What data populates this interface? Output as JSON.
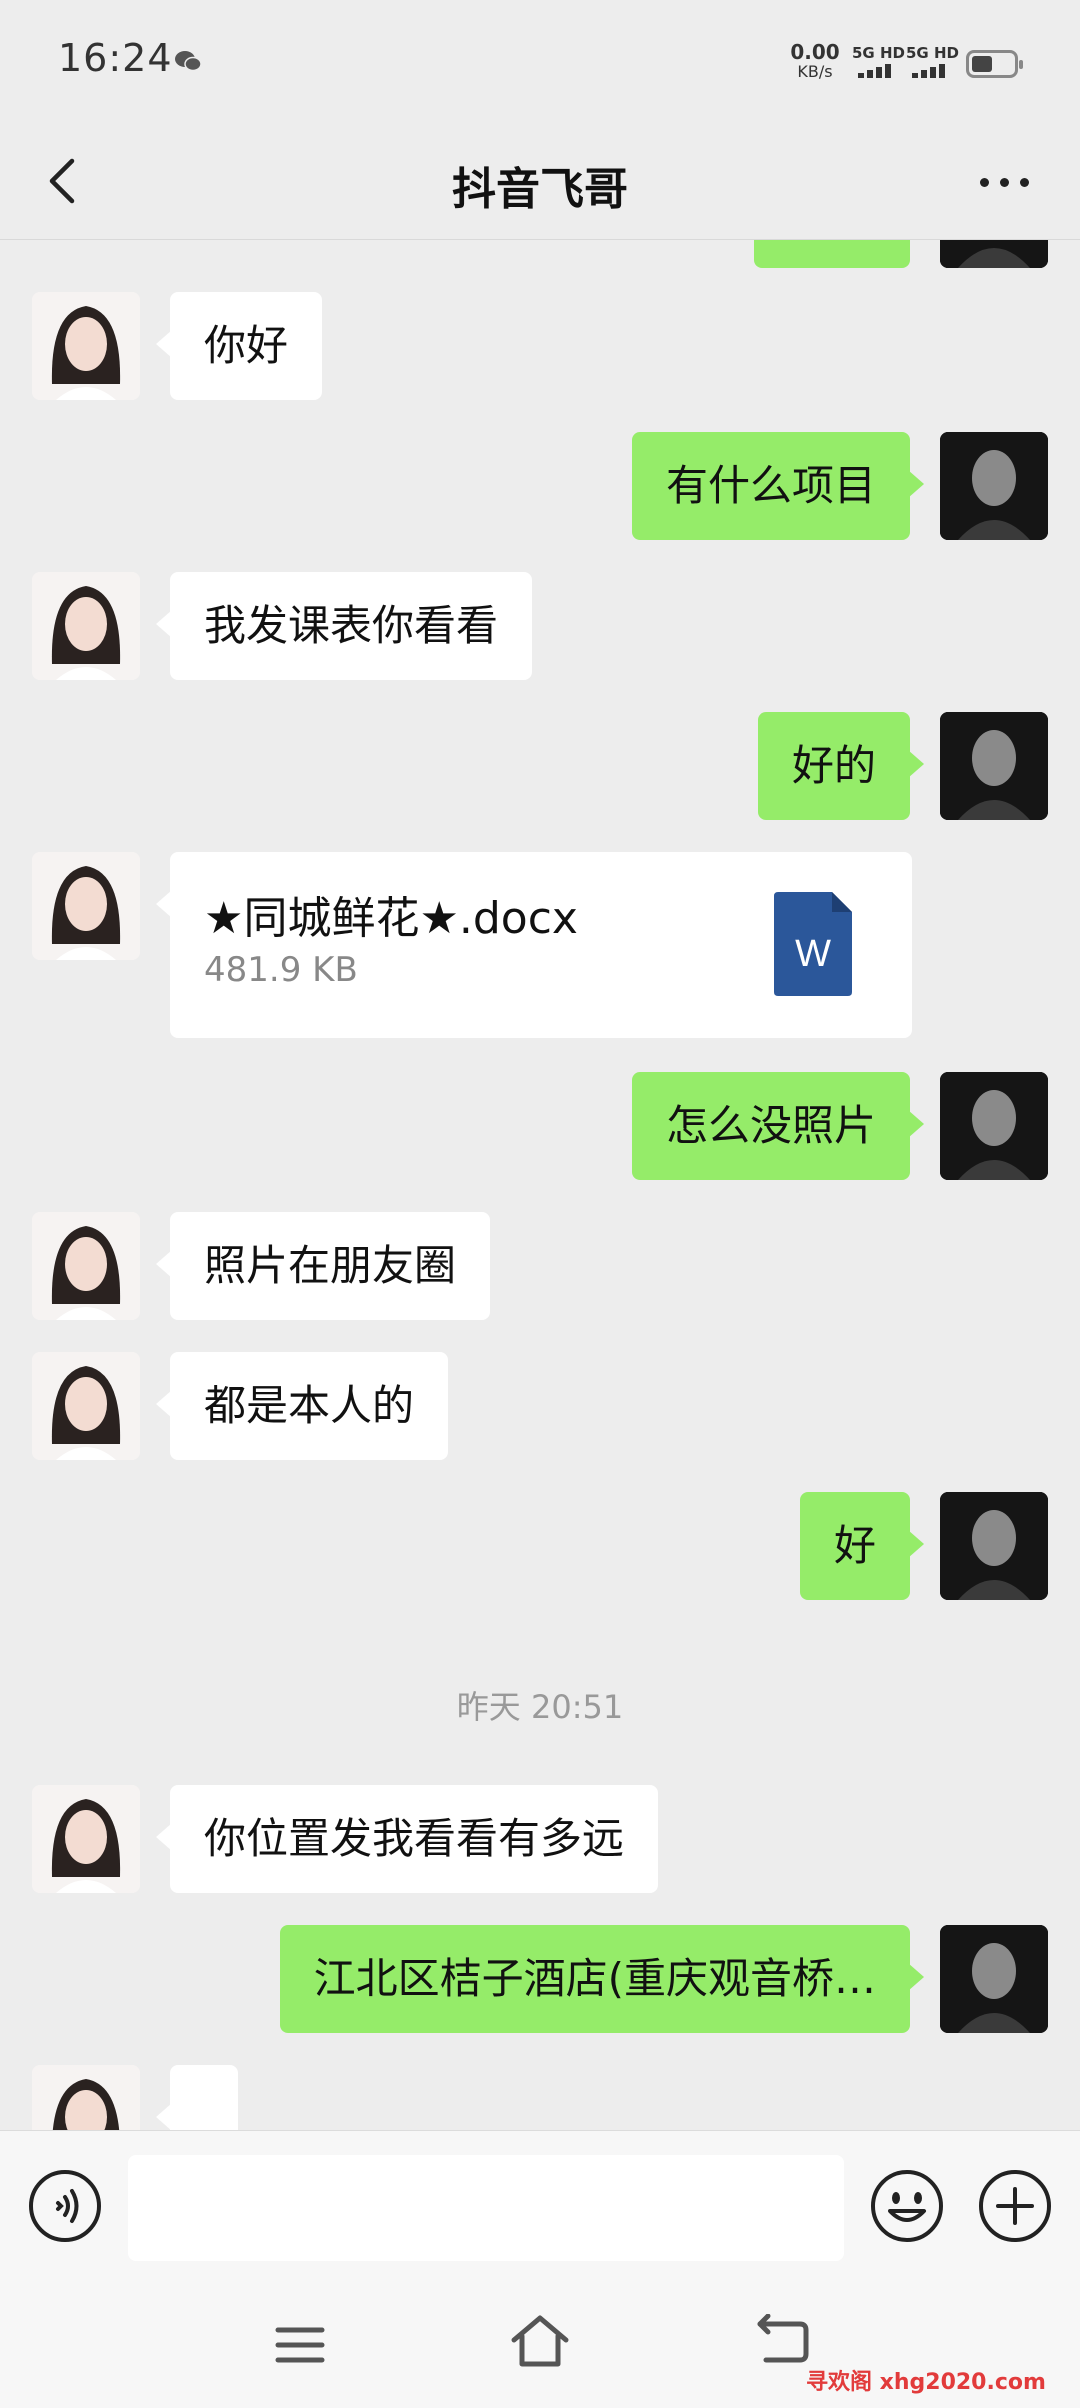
{
  "status_bar": {
    "time": "16:24",
    "net_speed": "0.00",
    "net_unit": "KB/s",
    "sim1": "5G HD",
    "sim2": "5G HD"
  },
  "header": {
    "title": "抖音飞哥"
  },
  "messages": [
    {
      "from": "them",
      "text": "你好"
    },
    {
      "from": "me",
      "text": "有什么项目"
    },
    {
      "from": "them",
      "text": "我发课表你看看"
    },
    {
      "from": "me",
      "text": "好的"
    },
    {
      "from": "them",
      "type": "file",
      "file_name": "★同城鲜花★.docx",
      "file_size": "481.9 KB",
      "file_icon_letter": "W"
    },
    {
      "from": "me",
      "text": "怎么没照片"
    },
    {
      "from": "them",
      "text": "照片在朋友圈"
    },
    {
      "from": "them",
      "text": "都是本人的"
    },
    {
      "from": "me",
      "text": "好"
    },
    {
      "from": "me",
      "text": "你位置发我看看有多远"
    },
    {
      "from": "them",
      "text": "江北区桔子酒店(重庆观音桥…"
    }
  ],
  "divider": {
    "timestamp": "昨天 20:51"
  },
  "input_bar": {
    "value": ""
  },
  "watermark": "寻欢阁 xhg2020.com",
  "colors": {
    "background": "#ededed",
    "my_bubble": "#95ec69",
    "their_bubble": "#ffffff",
    "word_blue": "#2b579a"
  }
}
